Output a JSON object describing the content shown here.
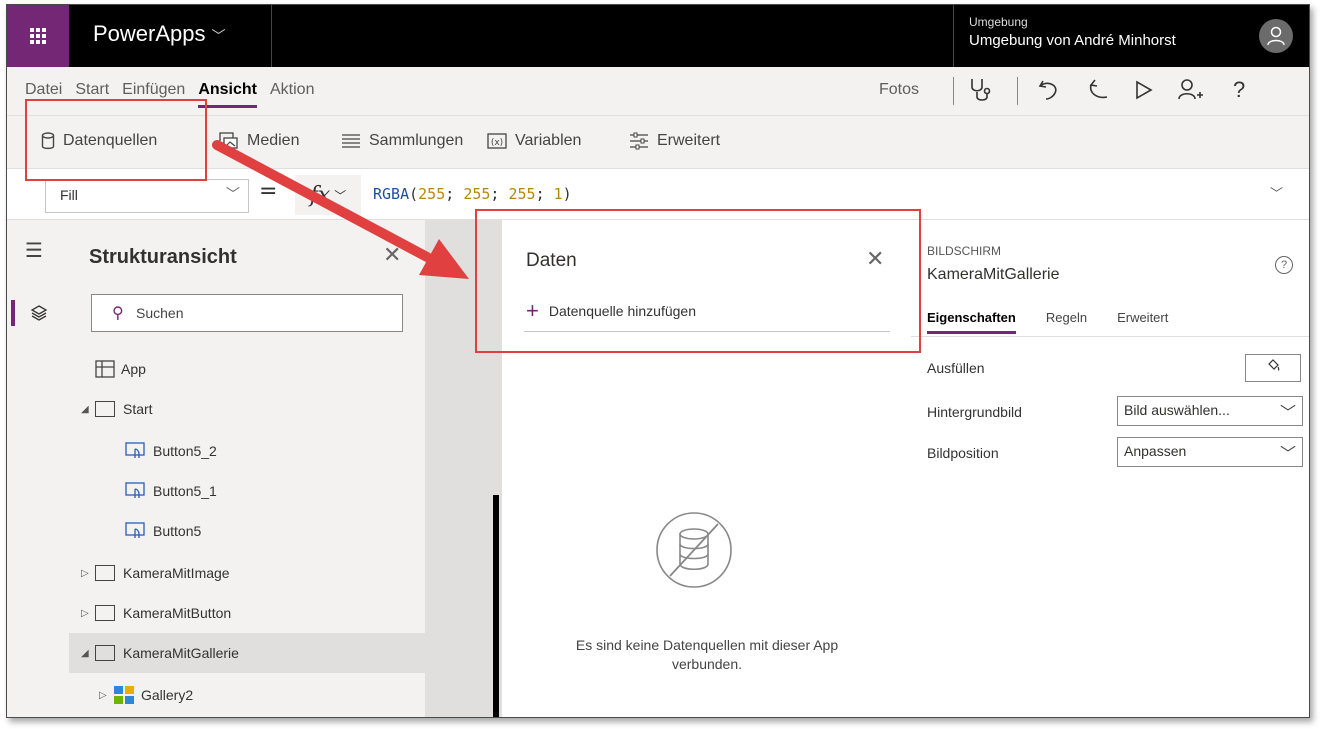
{
  "app": {
    "name": "PowerApps"
  },
  "environment": {
    "label": "Umgebung",
    "value": "Umgebung von André Minhorst"
  },
  "menu": {
    "items": [
      "Datei",
      "Start",
      "Einfügen",
      "Ansicht",
      "Aktion"
    ],
    "active": "Ansicht",
    "fotos": "Fotos"
  },
  "ribbon": {
    "items": [
      "Datenquellen",
      "Medien",
      "Sammlungen",
      "Variablen",
      "Erweitert"
    ]
  },
  "formula": {
    "property": "Fill",
    "fn": "RGBA",
    "args": [
      "255",
      "255",
      "255",
      "1"
    ]
  },
  "tree": {
    "title": "Strukturansicht",
    "search_placeholder": "Suchen",
    "nodes": [
      "App",
      "Start",
      "Button5_2",
      "Button5_1",
      "Button5",
      "KameraMitImage",
      "KameraMitButton",
      "KameraMitGallerie",
      "Gallery2"
    ]
  },
  "data_panel": {
    "title": "Daten",
    "add_label": "Datenquelle hinzufügen",
    "empty_text": "Es sind keine Datenquellen mit dieser App verbunden."
  },
  "props": {
    "kind": "BILDSCHIRM",
    "name": "KameraMitGallerie",
    "tabs": [
      "Eigenschaften",
      "Regeln",
      "Erweitert"
    ],
    "active_tab": "Eigenschaften",
    "rows": {
      "fill_label": "Ausfüllen",
      "bg_label": "Hintergrundbild",
      "bg_value": "Bild auswählen...",
      "pos_label": "Bildposition",
      "pos_value": "Anpassen"
    }
  },
  "colors": {
    "accent": "#742774",
    "annotation": "#e04040"
  }
}
